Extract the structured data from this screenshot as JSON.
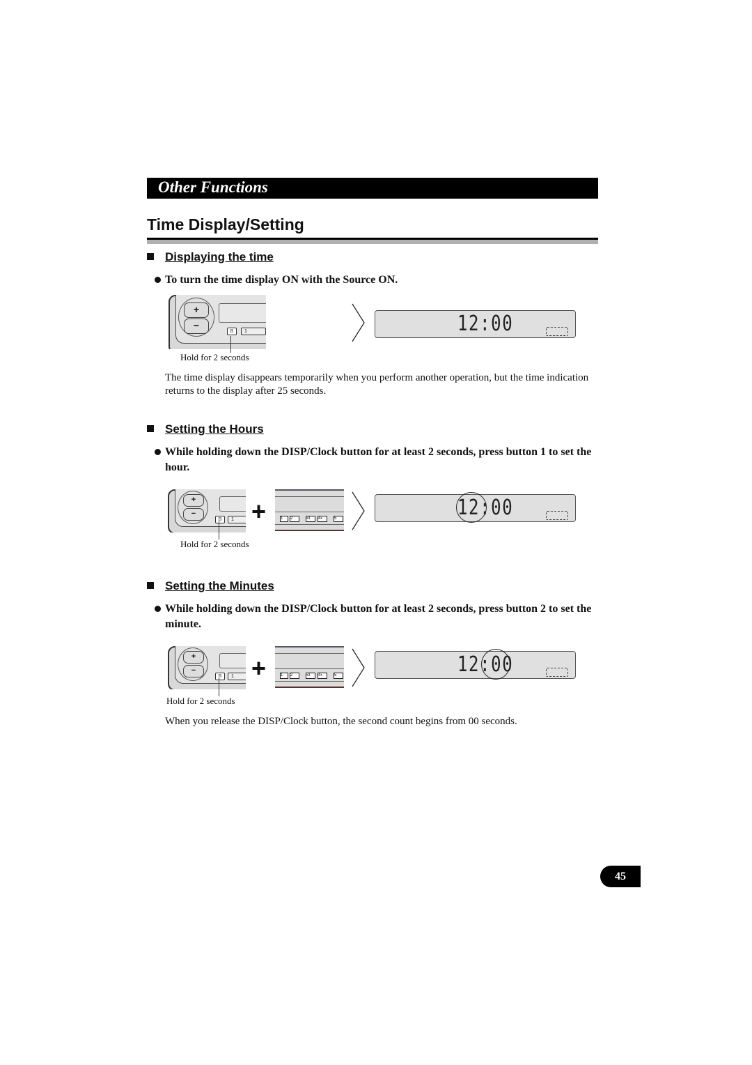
{
  "banner": {
    "title": "Other Functions"
  },
  "page_title": "Time Display/Setting",
  "sections": [
    {
      "heading": "Displaying the time",
      "instruction": "To turn the time display ON with the Source ON.",
      "caption": "Hold for 2 seconds",
      "display": "12:00",
      "note": "The time display disappears temporarily when you perform another operation, but the time indication returns to the display after 25 seconds."
    },
    {
      "heading": "Setting the Hours",
      "instruction": "While holding down the DISP/Clock button for at least 2 seconds, press button 1 to set the hour.",
      "caption": "Hold for 2 seconds",
      "display": "12:00",
      "highlight": "hours"
    },
    {
      "heading": "Setting the Minutes",
      "instruction": "While holding down the DISP/Clock button for at least 2 seconds, press button 2 to set the minute.",
      "caption": "Hold for 2 seconds",
      "display": "12:00",
      "highlight": "minutes",
      "note": "When you release the DISP/Clock button, the second count begins from 00 seconds."
    }
  ],
  "unit": {
    "plus_key": "+",
    "minus_key": "−",
    "disp_key": "B",
    "preset_1": "1"
  },
  "preset_strip": {
    "buttons": [
      "1",
      "2",
      "▪3",
      "4▪",
      "5"
    ]
  },
  "combo_symbol": "+",
  "page_number": "45"
}
